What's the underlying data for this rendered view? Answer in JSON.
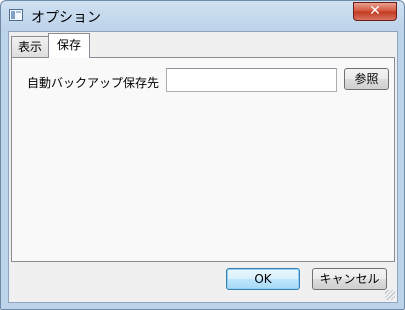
{
  "window": {
    "title": "オプション",
    "close_glyph": "✕"
  },
  "tabs": [
    {
      "label": "表示",
      "active": false
    },
    {
      "label": "保存",
      "active": true
    }
  ],
  "save_panel": {
    "backup_label": "自動バックアップ保存先",
    "backup_path_value": "",
    "browse_label": "参照"
  },
  "dialog_buttons": {
    "ok_label": "OK",
    "cancel_label": "キャンセル"
  },
  "colors": {
    "title_bar": "#bdd3ea",
    "close_button": "#c1391f",
    "ok_button_border": "#3c7fb1"
  }
}
